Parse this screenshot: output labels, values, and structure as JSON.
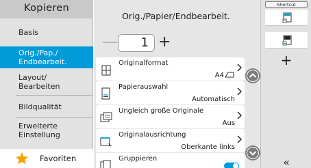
{
  "left_panel": {
    "title": "Kopieren",
    "items": [
      {
        "label": "Basis"
      },
      {
        "label": "Orig./Pap./\nEndbearbeit."
      },
      {
        "label": "Layout/\nBearbeiten"
      },
      {
        "label": "Bildqualität"
      },
      {
        "label": "Erweiterte\nEinstellung"
      }
    ],
    "favorites_label": "Favoriten"
  },
  "center": {
    "title": "Orig./Papier/Endbearbeit.",
    "copies_value": "1",
    "minus_symbol": "—",
    "plus_symbol": "+",
    "settings": [
      {
        "label": "Originalformat",
        "value": "A4"
      },
      {
        "label": "Papierauswahl",
        "value": "Automatisch"
      },
      {
        "label": "Ungleich große Originale",
        "value": "Aus"
      },
      {
        "label": "Originalausrichtung",
        "value": "Oberkante links"
      },
      {
        "label": "Gruppieren",
        "value": ""
      }
    ]
  },
  "right_panel": {
    "shortcut_label": "Shortcut",
    "add_symbol": "+",
    "back_symbol": "«"
  },
  "colors": {
    "accent": "#009ad9",
    "panel_bg": "#e2e2e2",
    "scroll_button": "#7c7c7c"
  }
}
